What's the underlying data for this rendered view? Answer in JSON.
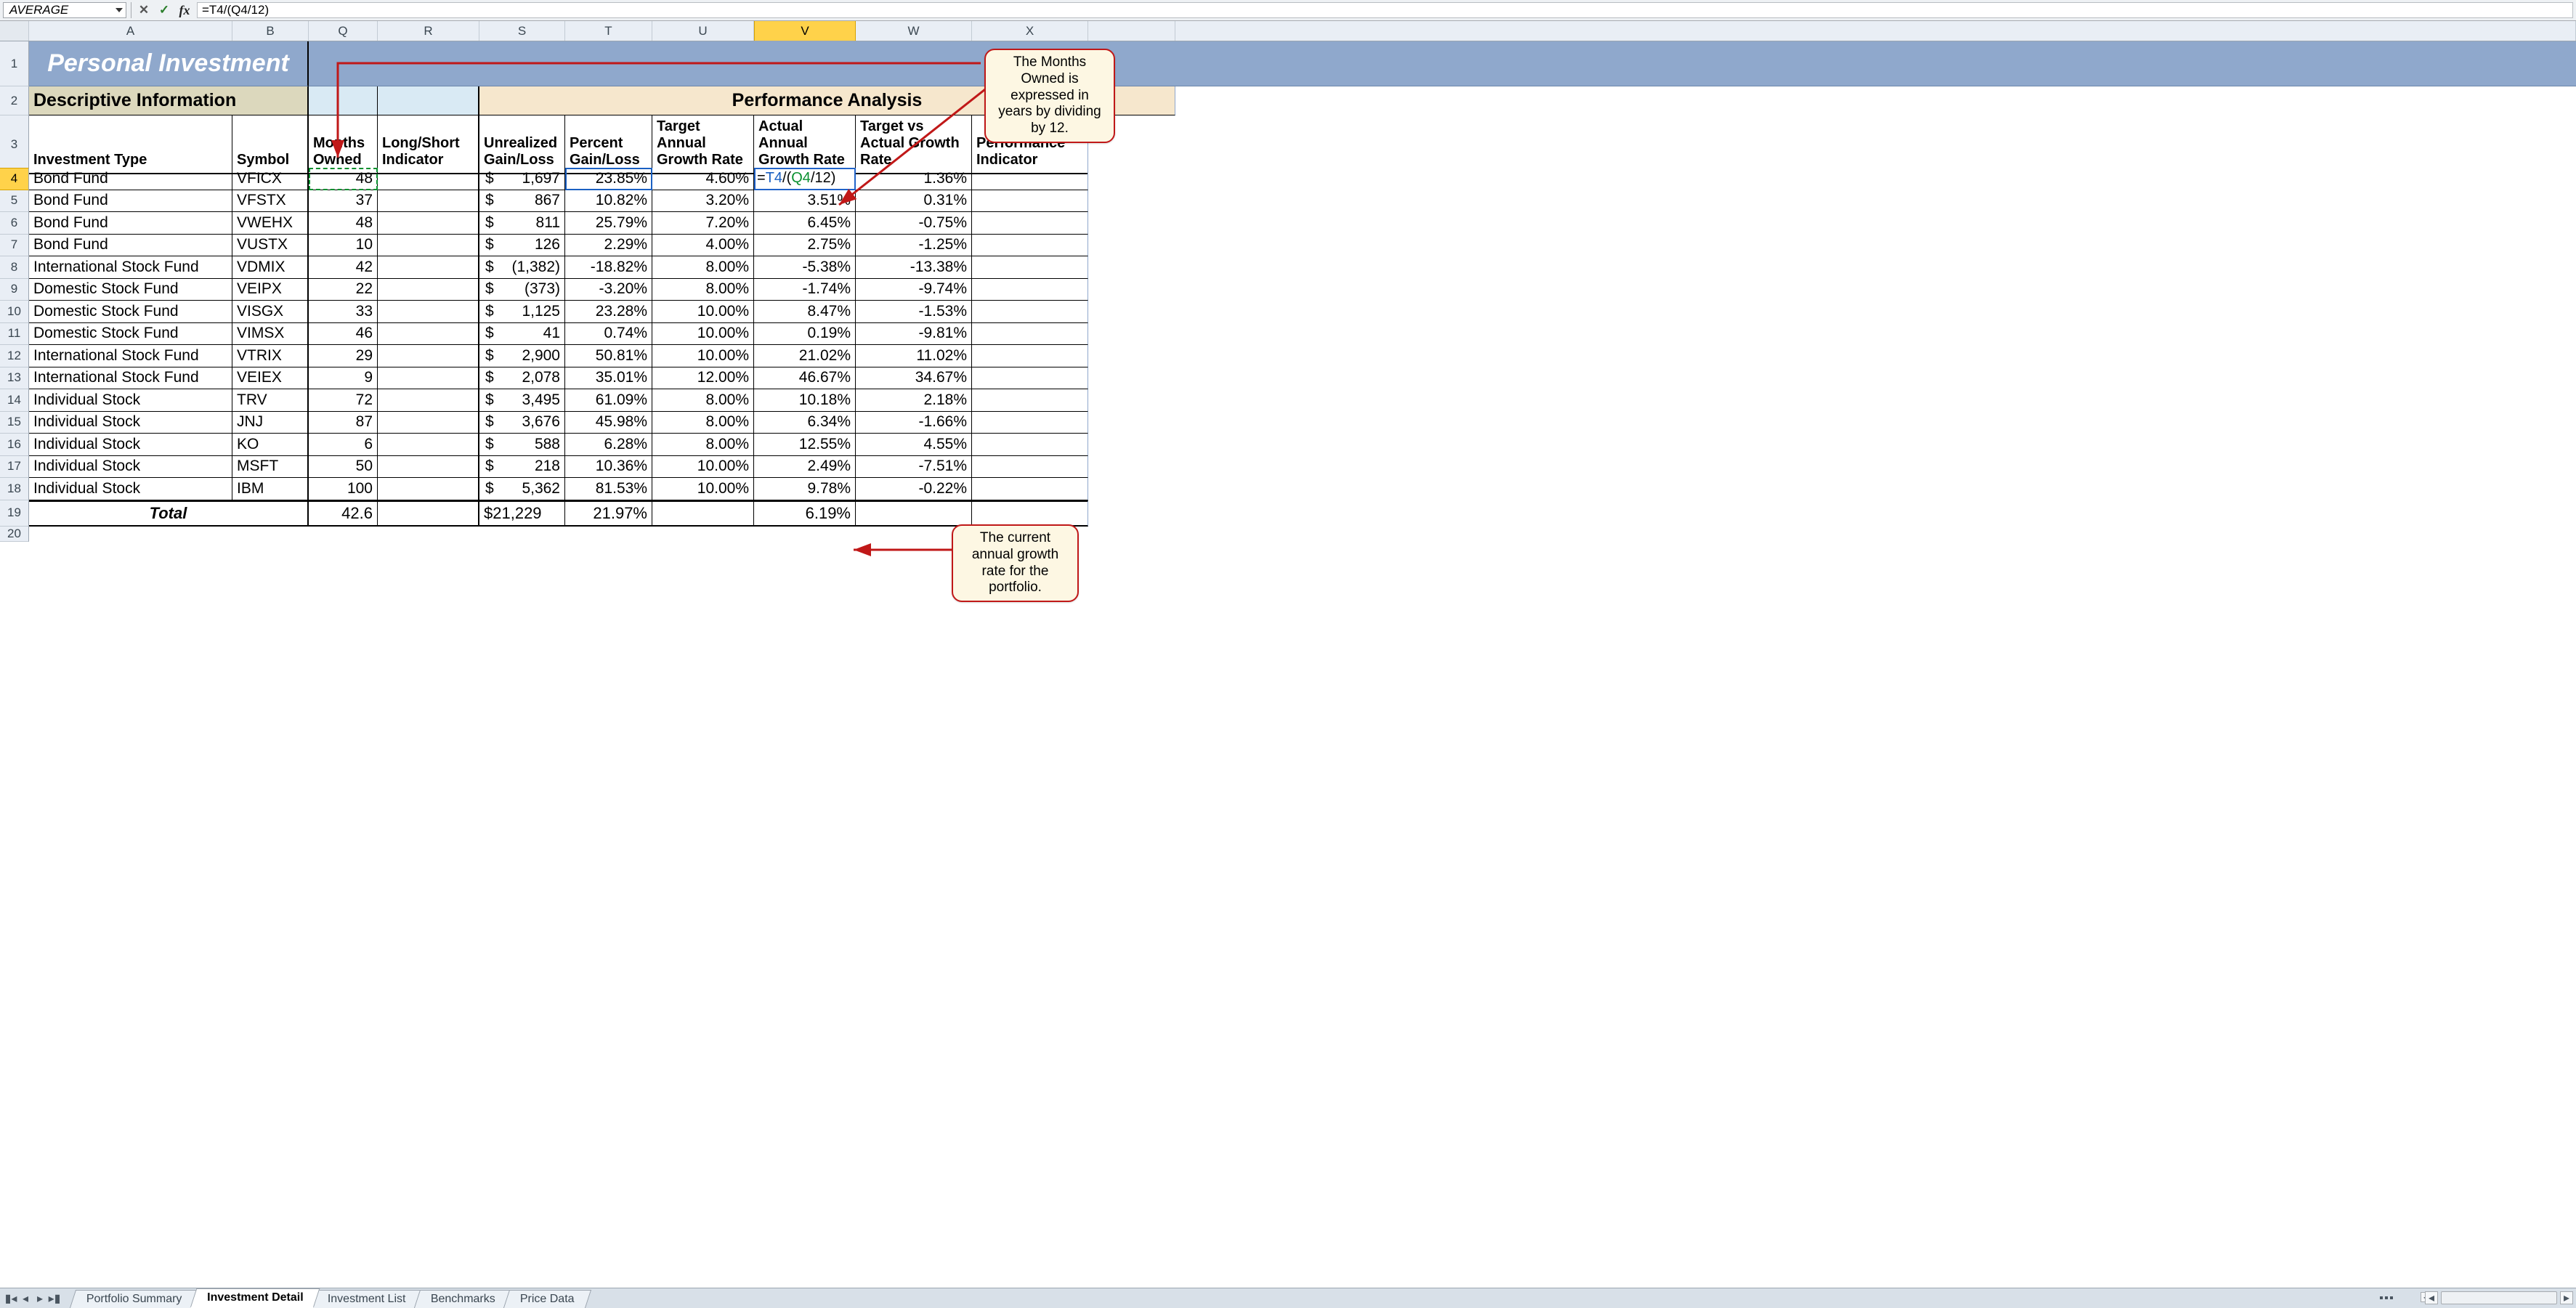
{
  "formula_bar": {
    "name_box": "AVERAGE",
    "cancel": "✕",
    "enter": "✓",
    "fx": "fx",
    "formula": "=T4/(Q4/12)"
  },
  "columns": [
    "",
    "A",
    "B",
    "Q",
    "R",
    "S",
    "T",
    "U",
    "V",
    "W",
    "X"
  ],
  "selected_column_index": 8,
  "banner_title": "Personal Investment",
  "section_descriptive": "Descriptive Information",
  "section_performance": "Performance Analysis",
  "headers": {
    "investment_type": "Investment Type",
    "symbol": "Symbol",
    "months_owned": "Months Owned",
    "long_short": "Long/Short Indicator",
    "unrealized": "Unrealized Gain/Loss",
    "percent_gl": "Percent Gain/Loss",
    "target_annual": "Target Annual Growth Rate",
    "actual_annual": "Actual Annual Growth Rate",
    "target_vs_actual": "Target vs Actual Growth Rate",
    "perf_ind": "Performance Indicator"
  },
  "edit_cell_display": "=T4/(Q4/12)",
  "rows": [
    {
      "n": 4,
      "type": "Bond Fund",
      "sym": "VFICX",
      "months": "48",
      "ugl": "1,697",
      "pct": "23.85%",
      "target": "4.60%",
      "actual": "=T4/(Q4/12)",
      "tva": "1.36%",
      "actual_is_formula": true
    },
    {
      "n": 5,
      "type": "Bond Fund",
      "sym": "VFSTX",
      "months": "37",
      "ugl": "867",
      "pct": "10.82%",
      "target": "3.20%",
      "actual": "3.51%",
      "tva": "0.31%"
    },
    {
      "n": 6,
      "type": "Bond Fund",
      "sym": "VWEHX",
      "months": "48",
      "ugl": "811",
      "pct": "25.79%",
      "target": "7.20%",
      "actual": "6.45%",
      "tva": "-0.75%"
    },
    {
      "n": 7,
      "type": "Bond Fund",
      "sym": "VUSTX",
      "months": "10",
      "ugl": "126",
      "pct": "2.29%",
      "target": "4.00%",
      "actual": "2.75%",
      "tva": "-1.25%"
    },
    {
      "n": 8,
      "type": "International Stock Fund",
      "sym": "VDMIX",
      "months": "42",
      "ugl": "(1,382)",
      "pct": "-18.82%",
      "target": "8.00%",
      "actual": "-5.38%",
      "tva": "-13.38%"
    },
    {
      "n": 9,
      "type": "Domestic Stock Fund",
      "sym": "VEIPX",
      "months": "22",
      "ugl": "(373)",
      "pct": "-3.20%",
      "target": "8.00%",
      "actual": "-1.74%",
      "tva": "-9.74%"
    },
    {
      "n": 10,
      "type": "Domestic Stock Fund",
      "sym": "VISGX",
      "months": "33",
      "ugl": "1,125",
      "pct": "23.28%",
      "target": "10.00%",
      "actual": "8.47%",
      "tva": "-1.53%"
    },
    {
      "n": 11,
      "type": "Domestic Stock Fund",
      "sym": "VIMSX",
      "months": "46",
      "ugl": "41",
      "pct": "0.74%",
      "target": "10.00%",
      "actual": "0.19%",
      "tva": "-9.81%"
    },
    {
      "n": 12,
      "type": "International Stock Fund",
      "sym": "VTRIX",
      "months": "29",
      "ugl": "2,900",
      "pct": "50.81%",
      "target": "10.00%",
      "actual": "21.02%",
      "tva": "11.02%"
    },
    {
      "n": 13,
      "type": "International Stock Fund",
      "sym": "VEIEX",
      "months": "9",
      "ugl": "2,078",
      "pct": "35.01%",
      "target": "12.00%",
      "actual": "46.67%",
      "tva": "34.67%"
    },
    {
      "n": 14,
      "type": "Individual Stock",
      "sym": "TRV",
      "months": "72",
      "ugl": "3,495",
      "pct": "61.09%",
      "target": "8.00%",
      "actual": "10.18%",
      "tva": "2.18%"
    },
    {
      "n": 15,
      "type": "Individual Stock",
      "sym": "JNJ",
      "months": "87",
      "ugl": "3,676",
      "pct": "45.98%",
      "target": "8.00%",
      "actual": "6.34%",
      "tva": "-1.66%"
    },
    {
      "n": 16,
      "type": "Individual Stock",
      "sym": "KO",
      "months": "6",
      "ugl": "588",
      "pct": "6.28%",
      "target": "8.00%",
      "actual": "12.55%",
      "tva": "4.55%"
    },
    {
      "n": 17,
      "type": "Individual Stock",
      "sym": "MSFT",
      "months": "50",
      "ugl": "218",
      "pct": "10.36%",
      "target": "10.00%",
      "actual": "2.49%",
      "tva": "-7.51%"
    },
    {
      "n": 18,
      "type": "Individual Stock",
      "sym": "IBM",
      "months": "100",
      "ugl": "5,362",
      "pct": "81.53%",
      "target": "10.00%",
      "actual": "9.78%",
      "tva": "-0.22%"
    }
  ],
  "totals": {
    "label": "Total",
    "months": "42.6",
    "ugl": "21,229",
    "pct": "21.97%",
    "actual": "6.19%"
  },
  "callouts": {
    "months_owned": "The Months Owned is expressed in years by dividing by 12.",
    "current_rate": "The current annual growth rate for the portfolio."
  },
  "tabs": {
    "items": [
      "Portfolio Summary",
      "Investment Detail",
      "Investment List",
      "Benchmarks",
      "Price Data"
    ],
    "active_index": 1
  }
}
